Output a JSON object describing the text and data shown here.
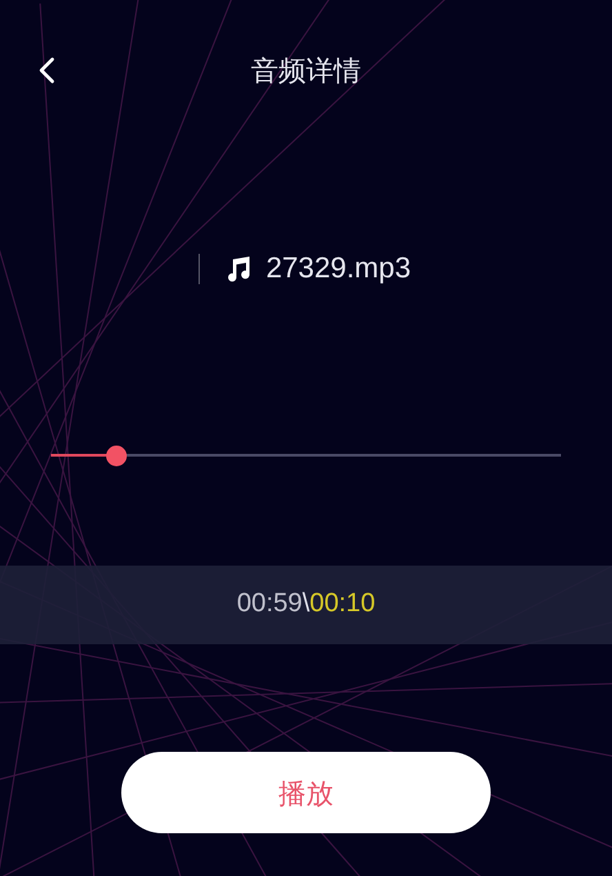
{
  "header": {
    "title": "音频详情"
  },
  "file": {
    "name": "27329.mp3"
  },
  "progress": {
    "level": 0.127
  },
  "time": {
    "total": "00:59",
    "separator": "\\",
    "current": "00:10"
  },
  "play_button": {
    "label": "播放"
  }
}
